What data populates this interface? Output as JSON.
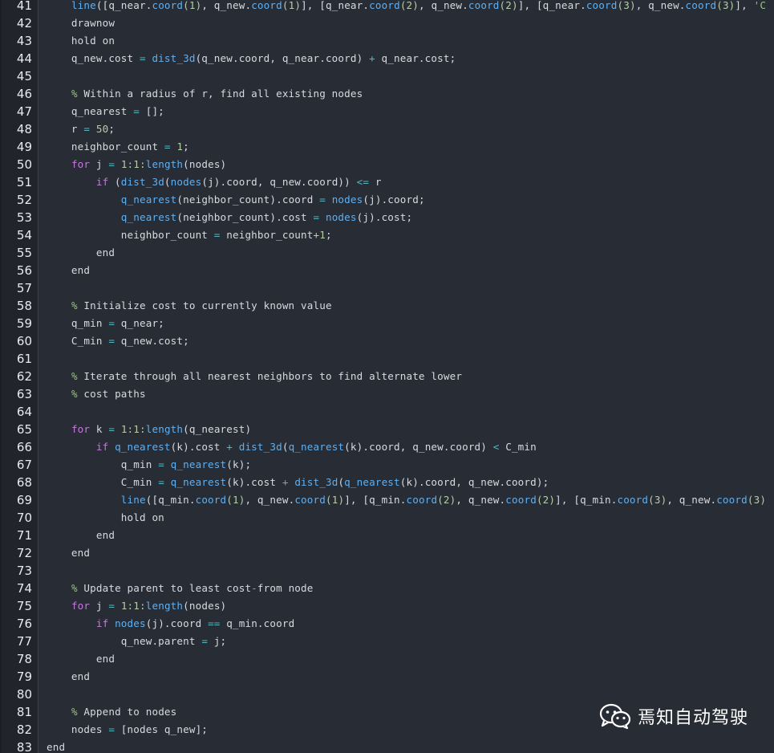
{
  "editor": {
    "language": "MATLAB",
    "lines": [
      {
        "n": "41",
        "tokens": [
          {
            "t": "    ",
            "c": "plain"
          },
          {
            "t": "line",
            "c": "fn"
          },
          {
            "t": "([q_near.",
            "c": "plain"
          },
          {
            "t": "coord",
            "c": "fn"
          },
          {
            "t": "(1)",
            "c": "num"
          },
          {
            "t": ", q_new.",
            "c": "plain"
          },
          {
            "t": "coord",
            "c": "fn"
          },
          {
            "t": "(1)",
            "c": "num"
          },
          {
            "t": "], [q_near.",
            "c": "plain"
          },
          {
            "t": "coord",
            "c": "fn"
          },
          {
            "t": "(2)",
            "c": "num"
          },
          {
            "t": ", q_new.",
            "c": "plain"
          },
          {
            "t": "coord",
            "c": "fn"
          },
          {
            "t": "(2)",
            "c": "num"
          },
          {
            "t": "], [q_near.",
            "c": "plain"
          },
          {
            "t": "coord",
            "c": "fn"
          },
          {
            "t": "(3)",
            "c": "num"
          },
          {
            "t": ", q_new.",
            "c": "plain"
          },
          {
            "t": "coord",
            "c": "fn"
          },
          {
            "t": "(3)",
            "c": "num"
          },
          {
            "t": "], ",
            "c": "plain"
          },
          {
            "t": "'C",
            "c": "str"
          }
        ]
      },
      {
        "n": "42",
        "tokens": [
          {
            "t": "    drawnow",
            "c": "plain"
          }
        ]
      },
      {
        "n": "43",
        "tokens": [
          {
            "t": "    hold on",
            "c": "plain"
          }
        ]
      },
      {
        "n": "44",
        "tokens": [
          {
            "t": "    q_new.cost ",
            "c": "plain"
          },
          {
            "t": "=",
            "c": "op"
          },
          {
            "t": " ",
            "c": "plain"
          },
          {
            "t": "dist_3d",
            "c": "fn"
          },
          {
            "t": "(q_new.coord, q_near.coord) ",
            "c": "plain"
          },
          {
            "t": "+",
            "c": "op"
          },
          {
            "t": " q_near.cost;",
            "c": "plain"
          }
        ]
      },
      {
        "n": "45",
        "tokens": []
      },
      {
        "n": "46",
        "tokens": [
          {
            "t": "    ",
            "c": "plain"
          },
          {
            "t": "%",
            "c": "com"
          },
          {
            "t": " Within a radius of r, find all existing nodes",
            "c": "plain"
          }
        ]
      },
      {
        "n": "47",
        "tokens": [
          {
            "t": "    q_nearest ",
            "c": "plain"
          },
          {
            "t": "=",
            "c": "op"
          },
          {
            "t": " [];",
            "c": "plain"
          }
        ]
      },
      {
        "n": "48",
        "tokens": [
          {
            "t": "    r ",
            "c": "plain"
          },
          {
            "t": "=",
            "c": "op"
          },
          {
            "t": " ",
            "c": "plain"
          },
          {
            "t": "50",
            "c": "num"
          },
          {
            "t": ";",
            "c": "plain"
          }
        ]
      },
      {
        "n": "49",
        "tokens": [
          {
            "t": "    neighbor_count ",
            "c": "plain"
          },
          {
            "t": "=",
            "c": "op"
          },
          {
            "t": " ",
            "c": "plain"
          },
          {
            "t": "1",
            "c": "num"
          },
          {
            "t": ";",
            "c": "plain"
          }
        ]
      },
      {
        "n": "50",
        "tokens": [
          {
            "t": "    ",
            "c": "plain"
          },
          {
            "t": "for",
            "c": "kw"
          },
          {
            "t": " j ",
            "c": "plain"
          },
          {
            "t": "=",
            "c": "op"
          },
          {
            "t": " ",
            "c": "plain"
          },
          {
            "t": "1:1:",
            "c": "num"
          },
          {
            "t": "length",
            "c": "fn"
          },
          {
            "t": "(nodes)",
            "c": "plain"
          }
        ]
      },
      {
        "n": "51",
        "tokens": [
          {
            "t": "        ",
            "c": "plain"
          },
          {
            "t": "if",
            "c": "kw"
          },
          {
            "t": " (",
            "c": "plain"
          },
          {
            "t": "dist_3d",
            "c": "fn"
          },
          {
            "t": "(",
            "c": "plain"
          },
          {
            "t": "nodes",
            "c": "fn"
          },
          {
            "t": "(j).coord, q_new.coord)) ",
            "c": "plain"
          },
          {
            "t": "<=",
            "c": "op"
          },
          {
            "t": " r",
            "c": "plain"
          }
        ]
      },
      {
        "n": "52",
        "tokens": [
          {
            "t": "            ",
            "c": "plain"
          },
          {
            "t": "q_nearest",
            "c": "fn"
          },
          {
            "t": "(neighbor_count).coord ",
            "c": "plain"
          },
          {
            "t": "=",
            "c": "op"
          },
          {
            "t": " ",
            "c": "plain"
          },
          {
            "t": "nodes",
            "c": "fn"
          },
          {
            "t": "(j).coord;",
            "c": "plain"
          }
        ]
      },
      {
        "n": "53",
        "tokens": [
          {
            "t": "            ",
            "c": "plain"
          },
          {
            "t": "q_nearest",
            "c": "fn"
          },
          {
            "t": "(neighbor_count).cost ",
            "c": "plain"
          },
          {
            "t": "=",
            "c": "op"
          },
          {
            "t": " ",
            "c": "plain"
          },
          {
            "t": "nodes",
            "c": "fn"
          },
          {
            "t": "(j).cost;",
            "c": "plain"
          }
        ]
      },
      {
        "n": "54",
        "tokens": [
          {
            "t": "            neighbor_count ",
            "c": "plain"
          },
          {
            "t": "=",
            "c": "op"
          },
          {
            "t": " neighbor_count",
            "c": "plain"
          },
          {
            "t": "+1",
            "c": "num"
          },
          {
            "t": ";",
            "c": "plain"
          }
        ]
      },
      {
        "n": "55",
        "tokens": [
          {
            "t": "        end",
            "c": "plain"
          }
        ]
      },
      {
        "n": "56",
        "tokens": [
          {
            "t": "    end",
            "c": "plain"
          }
        ]
      },
      {
        "n": "57",
        "tokens": []
      },
      {
        "n": "58",
        "tokens": [
          {
            "t": "    ",
            "c": "plain"
          },
          {
            "t": "%",
            "c": "com"
          },
          {
            "t": " Initialize cost to currently known value",
            "c": "plain"
          }
        ]
      },
      {
        "n": "59",
        "tokens": [
          {
            "t": "    q_min ",
            "c": "plain"
          },
          {
            "t": "=",
            "c": "op"
          },
          {
            "t": " q_near;",
            "c": "plain"
          }
        ]
      },
      {
        "n": "60",
        "tokens": [
          {
            "t": "    C_min ",
            "c": "plain"
          },
          {
            "t": "=",
            "c": "op"
          },
          {
            "t": " q_new.cost;",
            "c": "plain"
          }
        ]
      },
      {
        "n": "61",
        "tokens": []
      },
      {
        "n": "62",
        "tokens": [
          {
            "t": "    ",
            "c": "plain"
          },
          {
            "t": "%",
            "c": "com"
          },
          {
            "t": " Iterate through all nearest neighbors to find alternate lower",
            "c": "plain"
          }
        ]
      },
      {
        "n": "63",
        "tokens": [
          {
            "t": "    ",
            "c": "plain"
          },
          {
            "t": "%",
            "c": "com"
          },
          {
            "t": " cost paths",
            "c": "plain"
          }
        ]
      },
      {
        "n": "64",
        "tokens": []
      },
      {
        "n": "65",
        "tokens": [
          {
            "t": "    ",
            "c": "plain"
          },
          {
            "t": "for",
            "c": "kw"
          },
          {
            "t": " k ",
            "c": "plain"
          },
          {
            "t": "=",
            "c": "op"
          },
          {
            "t": " ",
            "c": "plain"
          },
          {
            "t": "1:1:",
            "c": "num"
          },
          {
            "t": "length",
            "c": "fn"
          },
          {
            "t": "(q_nearest)",
            "c": "plain"
          }
        ]
      },
      {
        "n": "66",
        "tokens": [
          {
            "t": "        ",
            "c": "plain"
          },
          {
            "t": "if",
            "c": "kw"
          },
          {
            "t": " ",
            "c": "plain"
          },
          {
            "t": "q_nearest",
            "c": "fn"
          },
          {
            "t": "(k).cost ",
            "c": "plain"
          },
          {
            "t": "+",
            "c": "op"
          },
          {
            "t": " ",
            "c": "plain"
          },
          {
            "t": "dist_3d",
            "c": "fn"
          },
          {
            "t": "(",
            "c": "plain"
          },
          {
            "t": "q_nearest",
            "c": "fn"
          },
          {
            "t": "(k).coord, q_new.coord) ",
            "c": "plain"
          },
          {
            "t": "<",
            "c": "op"
          },
          {
            "t": " C_min",
            "c": "plain"
          }
        ]
      },
      {
        "n": "67",
        "tokens": [
          {
            "t": "            q_min ",
            "c": "plain"
          },
          {
            "t": "=",
            "c": "op"
          },
          {
            "t": " ",
            "c": "plain"
          },
          {
            "t": "q_nearest",
            "c": "fn"
          },
          {
            "t": "(k);",
            "c": "plain"
          }
        ]
      },
      {
        "n": "68",
        "tokens": [
          {
            "t": "            C_min ",
            "c": "plain"
          },
          {
            "t": "=",
            "c": "op"
          },
          {
            "t": " ",
            "c": "plain"
          },
          {
            "t": "q_nearest",
            "c": "fn"
          },
          {
            "t": "(k).cost ",
            "c": "plain"
          },
          {
            "t": "+",
            "c": "op"
          },
          {
            "t": " ",
            "c": "plain"
          },
          {
            "t": "dist_3d",
            "c": "fn"
          },
          {
            "t": "(",
            "c": "plain"
          },
          {
            "t": "q_nearest",
            "c": "fn"
          },
          {
            "t": "(k).coord, q_new.coord);",
            "c": "plain"
          }
        ]
      },
      {
        "n": "69",
        "tokens": [
          {
            "t": "            ",
            "c": "plain"
          },
          {
            "t": "line",
            "c": "fn"
          },
          {
            "t": "([q_min.",
            "c": "plain"
          },
          {
            "t": "coord",
            "c": "fn"
          },
          {
            "t": "(1)",
            "c": "num"
          },
          {
            "t": ", q_new.",
            "c": "plain"
          },
          {
            "t": "coord",
            "c": "fn"
          },
          {
            "t": "(1)",
            "c": "num"
          },
          {
            "t": "], [q_min.",
            "c": "plain"
          },
          {
            "t": "coord",
            "c": "fn"
          },
          {
            "t": "(2)",
            "c": "num"
          },
          {
            "t": ", q_new.",
            "c": "plain"
          },
          {
            "t": "coord",
            "c": "fn"
          },
          {
            "t": "(2)",
            "c": "num"
          },
          {
            "t": "], [q_min.",
            "c": "plain"
          },
          {
            "t": "coord",
            "c": "fn"
          },
          {
            "t": "(3)",
            "c": "num"
          },
          {
            "t": ", q_new.",
            "c": "plain"
          },
          {
            "t": "coord",
            "c": "fn"
          },
          {
            "t": "(3)",
            "c": "num"
          }
        ]
      },
      {
        "n": "70",
        "tokens": [
          {
            "t": "            hold on",
            "c": "plain"
          }
        ]
      },
      {
        "n": "71",
        "tokens": [
          {
            "t": "        end",
            "c": "plain"
          }
        ]
      },
      {
        "n": "72",
        "tokens": [
          {
            "t": "    end",
            "c": "plain"
          }
        ]
      },
      {
        "n": "73",
        "tokens": []
      },
      {
        "n": "74",
        "tokens": [
          {
            "t": "    ",
            "c": "plain"
          },
          {
            "t": "%",
            "c": "com"
          },
          {
            "t": " Update parent to least cost",
            "c": "plain"
          },
          {
            "t": "-",
            "c": "op"
          },
          {
            "t": "from node",
            "c": "plain"
          }
        ]
      },
      {
        "n": "75",
        "tokens": [
          {
            "t": "    ",
            "c": "plain"
          },
          {
            "t": "for",
            "c": "kw"
          },
          {
            "t": " j ",
            "c": "plain"
          },
          {
            "t": "=",
            "c": "op"
          },
          {
            "t": " ",
            "c": "plain"
          },
          {
            "t": "1:1:",
            "c": "num"
          },
          {
            "t": "length",
            "c": "fn"
          },
          {
            "t": "(nodes)",
            "c": "plain"
          }
        ]
      },
      {
        "n": "76",
        "tokens": [
          {
            "t": "        ",
            "c": "plain"
          },
          {
            "t": "if",
            "c": "kw"
          },
          {
            "t": " ",
            "c": "plain"
          },
          {
            "t": "nodes",
            "c": "fn"
          },
          {
            "t": "(j).coord ",
            "c": "plain"
          },
          {
            "t": "==",
            "c": "op"
          },
          {
            "t": " q_min.coord",
            "c": "plain"
          }
        ]
      },
      {
        "n": "77",
        "tokens": [
          {
            "t": "            q_new.parent ",
            "c": "plain"
          },
          {
            "t": "=",
            "c": "op"
          },
          {
            "t": " j;",
            "c": "plain"
          }
        ]
      },
      {
        "n": "78",
        "tokens": [
          {
            "t": "        end",
            "c": "plain"
          }
        ]
      },
      {
        "n": "79",
        "tokens": [
          {
            "t": "    end",
            "c": "plain"
          }
        ]
      },
      {
        "n": "80",
        "tokens": []
      },
      {
        "n": "81",
        "tokens": [
          {
            "t": "    ",
            "c": "plain"
          },
          {
            "t": "%",
            "c": "com"
          },
          {
            "t": " Append to nodes",
            "c": "plain"
          }
        ]
      },
      {
        "n": "82",
        "tokens": [
          {
            "t": "    nodes ",
            "c": "plain"
          },
          {
            "t": "=",
            "c": "op"
          },
          {
            "t": " [nodes q_new];",
            "c": "plain"
          }
        ]
      },
      {
        "n": "83",
        "tokens": [
          {
            "t": "end",
            "c": "plain"
          }
        ]
      }
    ]
  },
  "watermark": {
    "icon": "wechat-icon",
    "text": "焉知自动驾驶"
  },
  "colors": {
    "background": "#282c34",
    "keyword": "#c678dd",
    "function": "#61afef",
    "number": "#b5cea8",
    "comment": "#98c379",
    "operator": "#56b6c2"
  }
}
